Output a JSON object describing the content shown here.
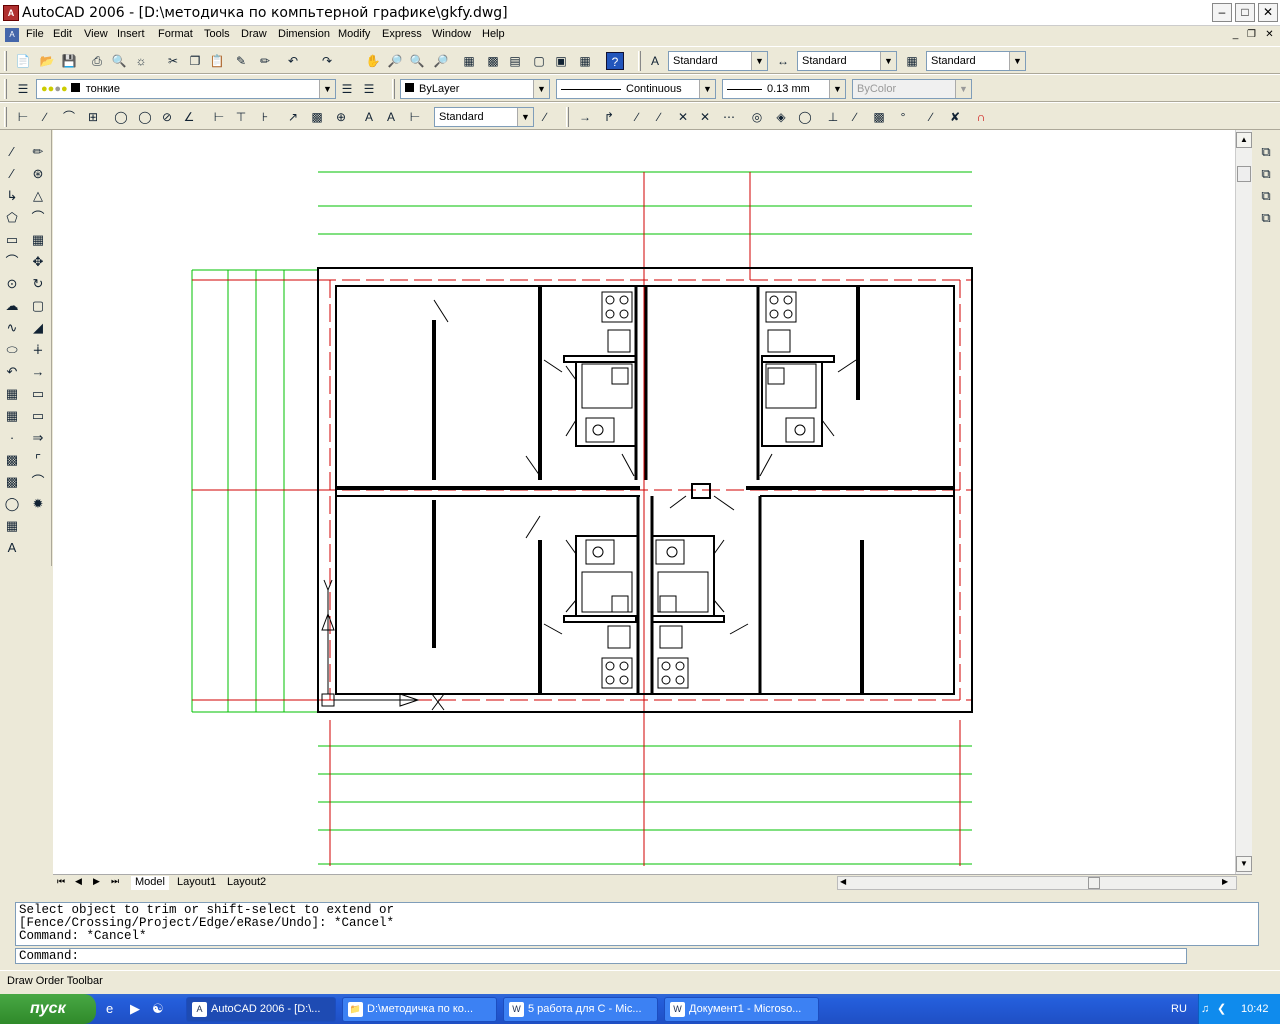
{
  "window": {
    "title": "AutoCAD 2006 - [D:\\методичка по компьтерной графике\\gkfy.dwg]"
  },
  "menu": [
    "File",
    "Edit",
    "View",
    "Insert",
    "Format",
    "Tools",
    "Draw",
    "Dimension",
    "Modify",
    "Express",
    "Window",
    "Help"
  ],
  "styles_toolbar": {
    "text_style": "Standard",
    "dim_style": "Standard",
    "table_style": "Standard"
  },
  "layers_toolbar": {
    "layer": "тонкие"
  },
  "properties_toolbar": {
    "color": "ByLayer",
    "linetype": "Continuous",
    "lineweight": "0.13 mm",
    "plotstyle": "ByColor"
  },
  "dimension_toolbar": {
    "dim_style": "Standard"
  },
  "tabs": [
    "Model",
    "Layout1",
    "Layout2"
  ],
  "command_history": [
    "Select object to trim or shift-select to extend or",
    "[Fence/Crossing/Project/Edge/eRase/Undo]: *Cancel*",
    "Command: *Cancel*"
  ],
  "command_prompt": "Command:",
  "status_text": "Draw Order Toolbar",
  "taskbar": {
    "start_label": "пуск",
    "tasks": [
      "AutoCAD 2006 - [D:\\...",
      "D:\\методичка по ко...",
      "5 работа для С - Mic...",
      "Документ1 - Microso..."
    ],
    "language": "RU",
    "clock": "10:42"
  },
  "colors": {
    "grid_line": "#00c000",
    "axis_line": "#d00000",
    "wall": "#000000"
  },
  "icons": {
    "ucs": "ucs-icon",
    "app": "autocad-icon"
  }
}
